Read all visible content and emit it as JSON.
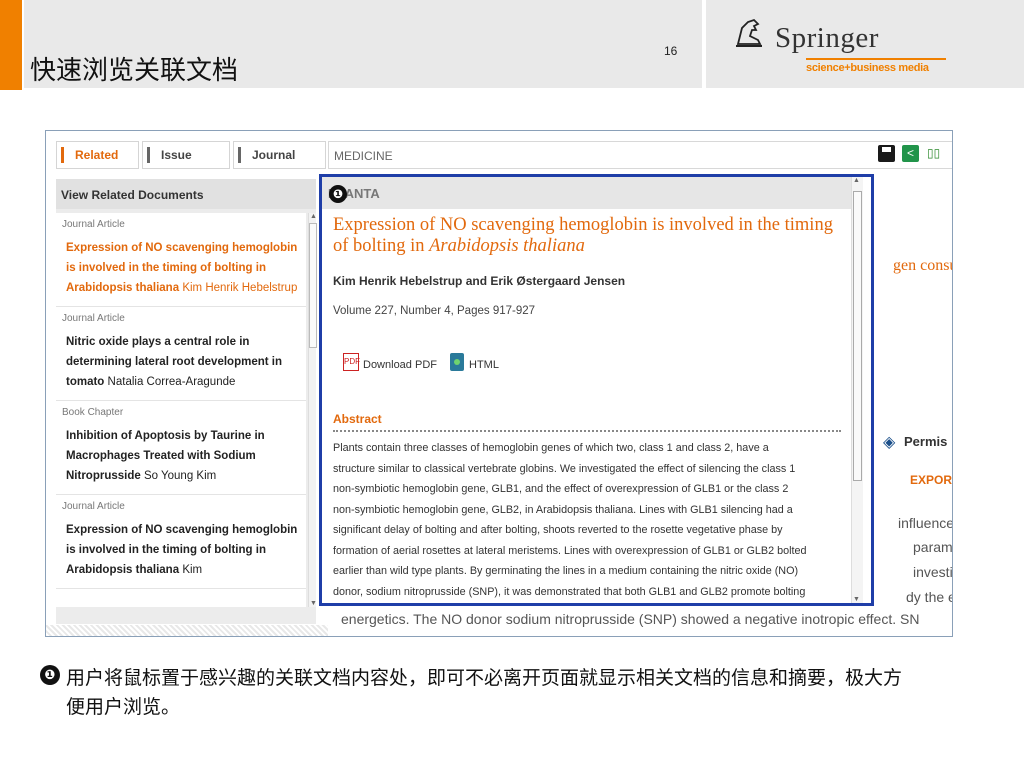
{
  "slide": {
    "title": "快速浏览关联文档",
    "page_number": "16"
  },
  "brand": {
    "name": "Springer",
    "tagline": "science+business media",
    "accent_color": "#f08000"
  },
  "tabs": [
    {
      "label": "Related",
      "active": true
    },
    {
      "label": "Issue",
      "active": false
    },
    {
      "label": "Journal",
      "active": false
    }
  ],
  "topbar": {
    "section": "MEDICINE",
    "icons": [
      "save-icon",
      "share-icon",
      "book-icon"
    ]
  },
  "sidebar": {
    "heading": "View Related Documents",
    "items": [
      {
        "type": "Journal Article",
        "title": "Expression of NO scavenging hemoglobin is involved in the timing of bolting in Arabidopsis thaliana",
        "author": "Kim Henrik Hebelstrup",
        "highlighted": true
      },
      {
        "type": "Journal Article",
        "title": "Nitric oxide plays a central role in determining lateral root development in tomato",
        "author": "Natalia Correa-Aragunde",
        "highlighted": false
      },
      {
        "type": "Book Chapter",
        "title": "Inhibition of Apoptosis by Taurine in Macrophages Treated with Sodium Nitroprusside",
        "author": "So Young Kim",
        "highlighted": false
      },
      {
        "type": "Journal Article",
        "title": "Expression of NO scavenging hemoglobin is involved in the timing of bolting in Arabidopsis thaliana",
        "author": "Kim",
        "highlighted": false
      }
    ]
  },
  "popup": {
    "journal": "PLANTA",
    "title_main": "Expression of NO scavenging hemoglobin is involved in the timing of bolting in ",
    "title_species": "Arabidopsis thaliana",
    "authors": "Kim Henrik Hebelstrup and Erik Østergaard Jensen",
    "volume": "Volume 227, Number 4, Pages 917-927",
    "download_pdf": "Download PDF",
    "html": "HTML",
    "abstract_heading": "Abstract",
    "abstract_lines": [
      "Plants contain three classes of hemoglobin genes of which two, class 1 and class 2, have a",
      "structure similar to classical vertebrate globins. We investigated the effect of silencing the class 1",
      "non-symbiotic hemoglobin gene, GLB1, and the effect of overexpression of GLB1 or the class 2",
      "non-symbiotic hemoglobin gene, GLB2, in Arabidopsis thaliana. Lines with GLB1 silencing had a",
      "significant delay of bolting and after bolting, shoots reverted to the rosette vegetative phase by",
      "formation of aerial rosettes at lateral meristems. Lines with overexpression of GLB1 or GLB2 bolted",
      "earlier than wild type plants. By germinating the lines in a medium containing the nitric oxide (NO)",
      "donor, sodium nitroprusside (SNP), it was demonstrated that both GLB1 and GLB2 promote bolting"
    ]
  },
  "background_fragments": {
    "title_tail": "gen consu",
    "permissions": "Permis",
    "export": "EXPORT CITAT",
    "line1": "influence of",
    "line2": "parameters",
    "line3": "investigat",
    "line4": "dy the effe",
    "bottom": "energetics. The NO donor sodium nitroprusside (SNP) showed a negative inotropic effect. SN"
  },
  "callout": {
    "marker": "❶",
    "caption": "用户将鼠标置于感兴趣的关联文档内容处，即可不必离开页面就显示相关文档的信息和摘要，极大方便用户浏览。"
  }
}
